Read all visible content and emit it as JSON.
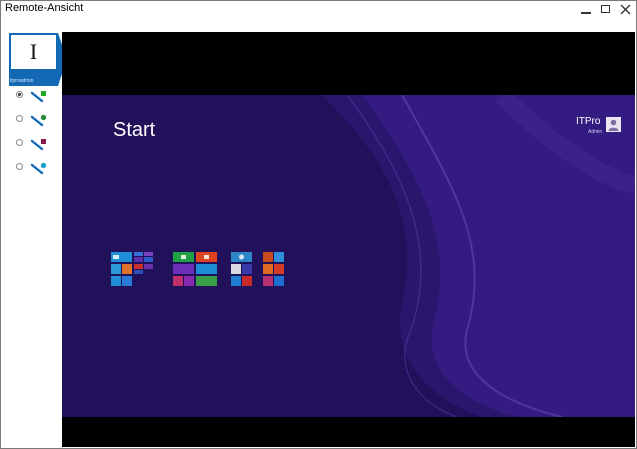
{
  "window": {
    "title": "Remote-Ansicht"
  },
  "sidebar": {
    "user_initial": "I",
    "user_label": "itproadmin",
    "connections": [
      {
        "selected": true,
        "plug_color": "#22aa22"
      },
      {
        "selected": false,
        "plug_color": "#2e8b3a"
      },
      {
        "selected": false,
        "plug_color": "#8b1a4a"
      },
      {
        "selected": false,
        "plug_color": "#1aa0c8"
      }
    ]
  },
  "desktop": {
    "start_label": "Start",
    "user_name": "ITPro",
    "user_role": "Admin"
  },
  "colors": {
    "accent_blue": "#1469b4",
    "desktop_bg": "#21105a",
    "remote_bg": "#000000"
  },
  "icons": [
    "minimize-icon",
    "maximize-icon",
    "close-icon",
    "network-plug-icon",
    "user-avatar-icon"
  ]
}
